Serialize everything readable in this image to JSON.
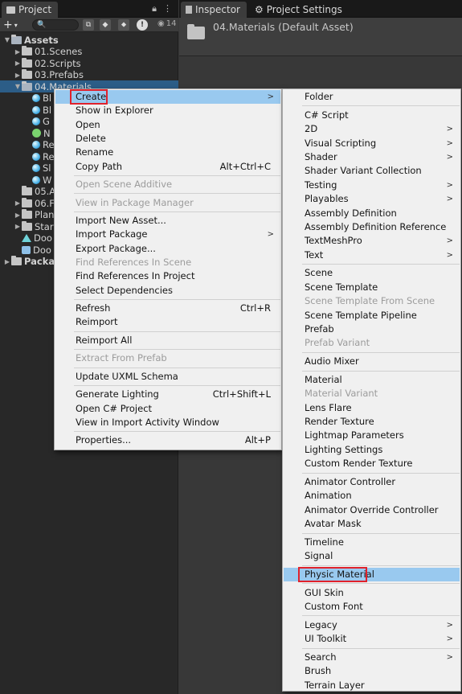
{
  "project_tab": {
    "title": "Project"
  },
  "toolbar": {
    "add_label": "+",
    "add_caret": "▾",
    "search_placeholder": "🔍",
    "hidden_count": "14"
  },
  "tree": [
    {
      "label": "Assets",
      "kind": "folder-open",
      "depth": 0,
      "arrow": "▼",
      "bold": true
    },
    {
      "label": "01.Scenes",
      "kind": "folder",
      "depth": 1,
      "arrow": "▶"
    },
    {
      "label": "02.Scripts",
      "kind": "folder",
      "depth": 1,
      "arrow": "▶"
    },
    {
      "label": "03.Prefabs",
      "kind": "folder",
      "depth": 1,
      "arrow": "▶"
    },
    {
      "label": "04.Materials",
      "kind": "folder-open",
      "depth": 1,
      "arrow": "▼",
      "selected": true
    },
    {
      "label": "Bl",
      "kind": "ball",
      "depth": 2
    },
    {
      "label": "Bl",
      "kind": "ball",
      "depth": 2
    },
    {
      "label": "G",
      "kind": "ball",
      "depth": 2
    },
    {
      "label": "N",
      "kind": "ms",
      "depth": 2
    },
    {
      "label": "Re",
      "kind": "ball",
      "depth": 2
    },
    {
      "label": "Re",
      "kind": "ball",
      "depth": 2
    },
    {
      "label": "Sl",
      "kind": "ball",
      "depth": 2
    },
    {
      "label": "W",
      "kind": "ball",
      "depth": 2
    },
    {
      "label": "05.A",
      "kind": "folder",
      "depth": 1
    },
    {
      "label": "06.F",
      "kind": "folder",
      "depth": 1,
      "arrow": "▶"
    },
    {
      "label": "Plan",
      "kind": "folder",
      "depth": 1,
      "arrow": "▶"
    },
    {
      "label": "Star",
      "kind": "folder",
      "depth": 1,
      "arrow": "▶"
    },
    {
      "label": "Doo",
      "kind": "tri",
      "depth": 1
    },
    {
      "label": "Doo",
      "kind": "prefab",
      "depth": 1
    },
    {
      "label": "Packa",
      "kind": "folder",
      "depth": 0,
      "arrow": "▶",
      "bold": true
    }
  ],
  "inspector": {
    "tab_inspector": "Inspector",
    "tab_settings": "Project Settings",
    "title": "04.Materials (Default Asset)"
  },
  "context_menu": {
    "items": [
      {
        "label": "Create",
        "arrow": ">",
        "highlight": true,
        "boxed": true
      },
      {
        "label": "Show in Explorer"
      },
      {
        "label": "Open"
      },
      {
        "label": "Delete"
      },
      {
        "label": "Rename"
      },
      {
        "label": "Copy Path",
        "shortcut": "Alt+Ctrl+C"
      },
      {
        "sep": true
      },
      {
        "label": "Open Scene Additive",
        "disabled": true
      },
      {
        "sep": true
      },
      {
        "label": "View in Package Manager",
        "disabled": true
      },
      {
        "sep": true
      },
      {
        "label": "Import New Asset..."
      },
      {
        "label": "Import Package",
        "arrow": ">"
      },
      {
        "label": "Export Package..."
      },
      {
        "label": "Find References In Scene",
        "disabled": true
      },
      {
        "label": "Find References In Project"
      },
      {
        "label": "Select Dependencies"
      },
      {
        "sep": true
      },
      {
        "label": "Refresh",
        "shortcut": "Ctrl+R"
      },
      {
        "label": "Reimport"
      },
      {
        "sep": true
      },
      {
        "label": "Reimport All"
      },
      {
        "sep": true
      },
      {
        "label": "Extract From Prefab",
        "disabled": true
      },
      {
        "sep": true
      },
      {
        "label": "Update UXML Schema"
      },
      {
        "sep": true
      },
      {
        "label": "Generate Lighting",
        "shortcut": "Ctrl+Shift+L"
      },
      {
        "label": "Open C# Project"
      },
      {
        "label": "View in Import Activity Window"
      },
      {
        "sep": true
      },
      {
        "label": "Properties...",
        "shortcut": "Alt+P"
      }
    ]
  },
  "create_submenu": {
    "items": [
      {
        "label": "Folder"
      },
      {
        "sep": true
      },
      {
        "label": "C# Script"
      },
      {
        "label": "2D",
        "arrow": ">"
      },
      {
        "label": "Visual Scripting",
        "arrow": ">"
      },
      {
        "label": "Shader",
        "arrow": ">"
      },
      {
        "label": "Shader Variant Collection"
      },
      {
        "label": "Testing",
        "arrow": ">"
      },
      {
        "label": "Playables",
        "arrow": ">"
      },
      {
        "label": "Assembly Definition"
      },
      {
        "label": "Assembly Definition Reference"
      },
      {
        "label": "TextMeshPro",
        "arrow": ">"
      },
      {
        "label": "Text",
        "arrow": ">"
      },
      {
        "sep": true
      },
      {
        "label": "Scene"
      },
      {
        "label": "Scene Template"
      },
      {
        "label": "Scene Template From Scene",
        "disabled": true
      },
      {
        "label": "Scene Template Pipeline"
      },
      {
        "label": "Prefab"
      },
      {
        "label": "Prefab Variant",
        "disabled": true
      },
      {
        "sep": true
      },
      {
        "label": "Audio Mixer"
      },
      {
        "sep": true
      },
      {
        "label": "Material"
      },
      {
        "label": "Material Variant",
        "disabled": true
      },
      {
        "label": "Lens Flare"
      },
      {
        "label": "Render Texture"
      },
      {
        "label": "Lightmap Parameters"
      },
      {
        "label": "Lighting Settings"
      },
      {
        "label": "Custom Render Texture"
      },
      {
        "sep": true
      },
      {
        "label": "Animator Controller"
      },
      {
        "label": "Animation"
      },
      {
        "label": "Animator Override Controller"
      },
      {
        "label": "Avatar Mask"
      },
      {
        "sep": true
      },
      {
        "label": "Timeline"
      },
      {
        "label": "Signal"
      },
      {
        "sep": true
      },
      {
        "label": "Physic Material",
        "highlight": true,
        "boxed": true
      },
      {
        "sep": true
      },
      {
        "label": "GUI Skin"
      },
      {
        "label": "Custom Font"
      },
      {
        "sep": true
      },
      {
        "label": "Legacy",
        "arrow": ">"
      },
      {
        "label": "UI Toolkit",
        "arrow": ">"
      },
      {
        "sep": true
      },
      {
        "label": "Search",
        "arrow": ">"
      },
      {
        "label": "Brush"
      },
      {
        "label": "Terrain Layer"
      }
    ]
  }
}
